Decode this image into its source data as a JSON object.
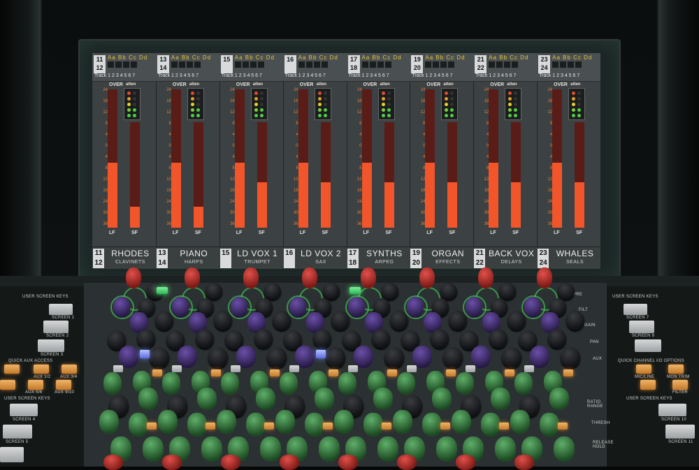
{
  "console": {
    "channels": [
      {
        "num_top": "11",
        "num_bottom": "12",
        "name": "RHODES",
        "subname": "CLAVINETS",
        "lf": 0.47,
        "sf": 0.2
      },
      {
        "num_top": "13",
        "num_bottom": "14",
        "name": "PIANO",
        "subname": "HARPS",
        "lf": 0.47,
        "sf": 0.2
      },
      {
        "num_top": "15",
        "num_bottom": "",
        "name": "LD VOX 1",
        "subname": "TRUMPET",
        "lf": 0.47,
        "sf": 0.43
      },
      {
        "num_top": "16",
        "num_bottom": "",
        "name": "LD VOX 2",
        "subname": "SAX",
        "lf": 0.47,
        "sf": 0.43
      },
      {
        "num_top": "17",
        "num_bottom": "18",
        "name": "SYNTHS",
        "subname": "ARPEG",
        "lf": 0.47,
        "sf": 0.43
      },
      {
        "num_top": "19",
        "num_bottom": "20",
        "name": "ORGAN",
        "subname": "EFFECTS",
        "lf": 0.47,
        "sf": 0.43
      },
      {
        "num_top": "21",
        "num_bottom": "22",
        "name": "BACK VOX",
        "subname": "DELAYS",
        "lf": 0.47,
        "sf": 0.43
      },
      {
        "num_top": "23",
        "num_bottom": "24",
        "name": "WHALES",
        "subname": "SEALS",
        "lf": 0.47,
        "sf": 0.43
      }
    ],
    "header_letters": "Aa Bb Cc Dd",
    "track_label": "Track",
    "track_digits": "1 2 3 4 5 6 7",
    "meter_scale": [
      "24",
      "18",
      "12",
      "8",
      "4",
      "0",
      "4",
      "8",
      "12",
      "18",
      "24",
      "30",
      "36"
    ],
    "over_label": "OVER",
    "atten_label": "atten",
    "db_label": "dB",
    "lf_label": "LF",
    "sf_label": "SF",
    "gr_scale": [
      "20",
      "14",
      "10",
      "6",
      "3"
    ]
  },
  "left_panel": {
    "user_screen_keys_top": "USER SCREEN KEYS",
    "screen1": "SCREEN 1",
    "screen2": "SCREEN 2",
    "screen3": "SCREEN 3",
    "quick_aux_access": "QUICK AUX ACCESS",
    "aux12": "AUX 1/2",
    "aux34": "AUX 3/4",
    "aux56": "AUX 5/6",
    "aux78": "AUX 7/8",
    "aux910": "AUX 9/10",
    "user_screen_keys_bottom": "USER SCREEN KEYS",
    "screen4": "SCREEN 4",
    "screen5": "SCREEN 5"
  },
  "right_panel": {
    "user_screen_keys_top": "USER SCREEN KEYS",
    "screen7": "SCREEN 7",
    "screen8": "SCREEN 8",
    "quick_channel_io_options": "QUICK CHANNEL I/O OPTIONS",
    "mic_line": "MIC/LINE",
    "mon_trim": "MON TRIM",
    "filter": "FILTER",
    "user_screen_keys_bottom": "USER SCREEN KEYS",
    "screen10": "SCREEN 10",
    "screen11": "SCREEN 11"
  },
  "row_labels": {
    "pre": "PRE",
    "filt": "FILT",
    "gain": "GAIN",
    "pan": "PAN",
    "aux": "AUX",
    "ratio_range": "RATIO RANGE",
    "thresh": "THRESH",
    "release_hold": "RELEASE HOLD",
    "aux_on": "AUX ON",
    "dynamic": "DYNAMIC"
  }
}
